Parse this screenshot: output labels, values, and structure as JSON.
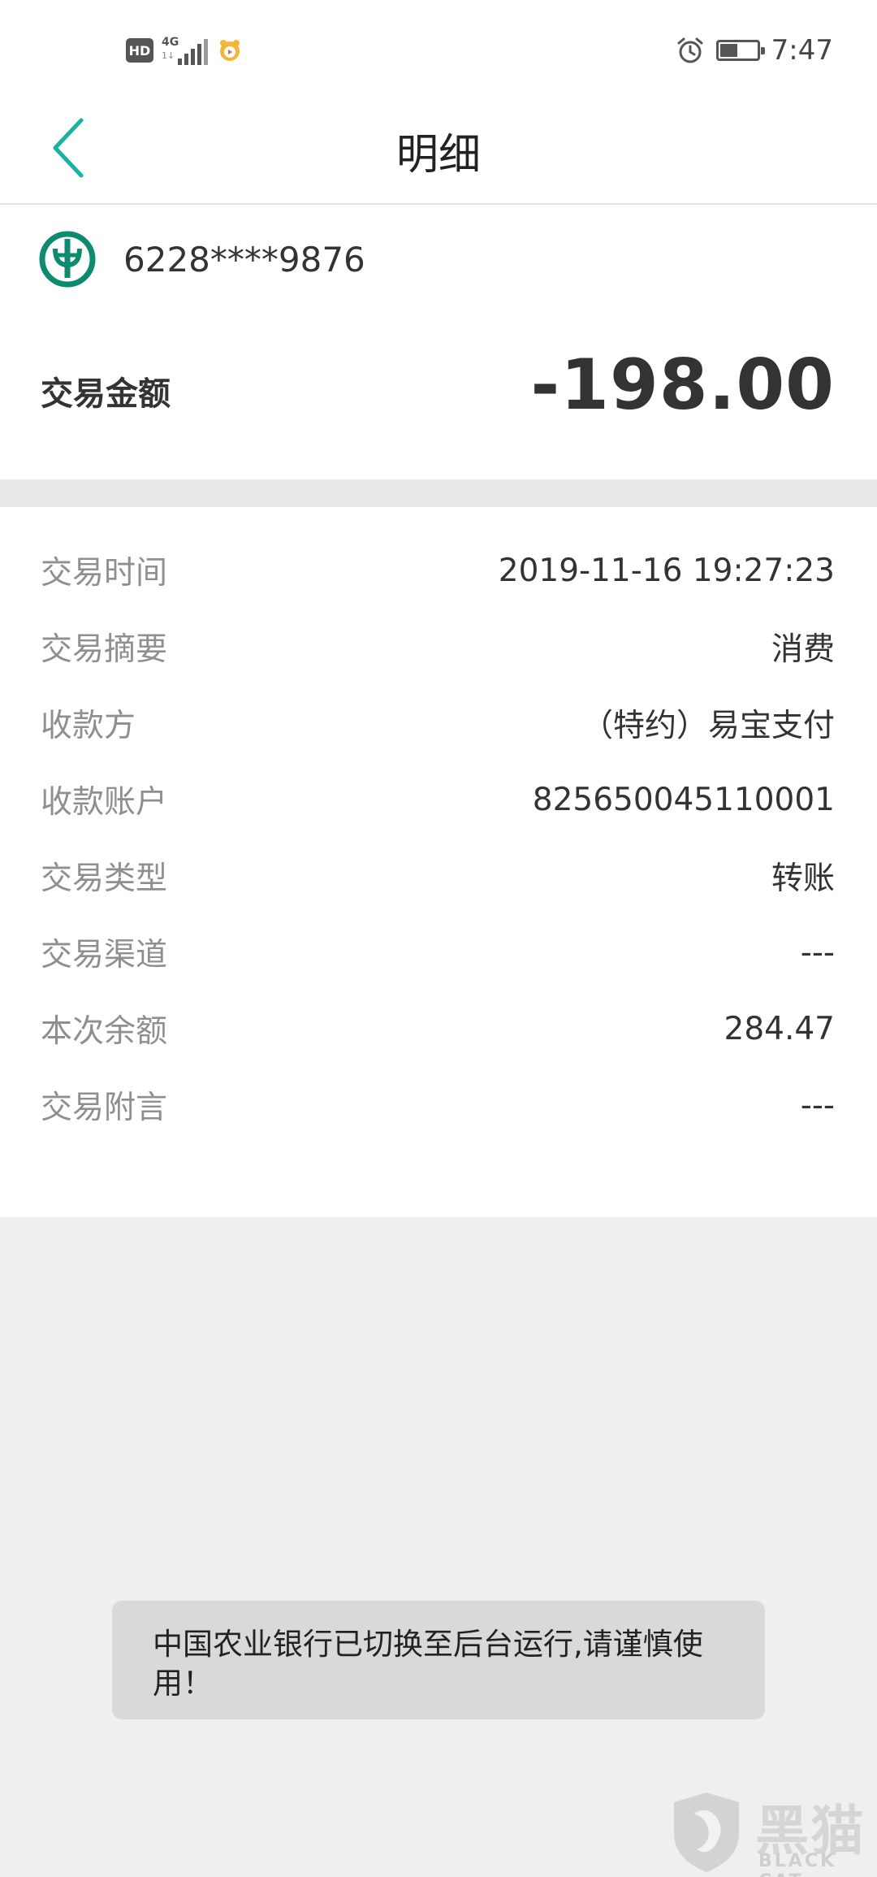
{
  "status_bar": {
    "hd_label": "HD",
    "network_label": "4G",
    "network_sub": "1↓",
    "time": "7:47",
    "battery_level": 0.45
  },
  "nav": {
    "title": "明细",
    "back_icon": "chevron-left-icon",
    "accent_color": "#19b3a6"
  },
  "summary": {
    "card_number": "6228****9876",
    "bank_logo_color": "#0d8b6e",
    "amount_label": "交易金额",
    "amount_value": "-198.00"
  },
  "details": [
    {
      "label": "交易时间",
      "value": "2019-11-16 19:27:23"
    },
    {
      "label": "交易摘要",
      "value": "消费"
    },
    {
      "label": "收款方",
      "value": "（特约）易宝支付"
    },
    {
      "label": "收款账户",
      "value": "825650045110001"
    },
    {
      "label": "交易类型",
      "value": "转账"
    },
    {
      "label": "交易渠道",
      "value": "---"
    },
    {
      "label": "本次余额",
      "value": "284.47"
    },
    {
      "label": "交易附言",
      "value": "---"
    }
  ],
  "toast": {
    "message": "中国农业银行已切换至后台运行,请谨慎使用！"
  },
  "watermark": {
    "text": "黑猫",
    "sub": "BLACK CAT"
  }
}
